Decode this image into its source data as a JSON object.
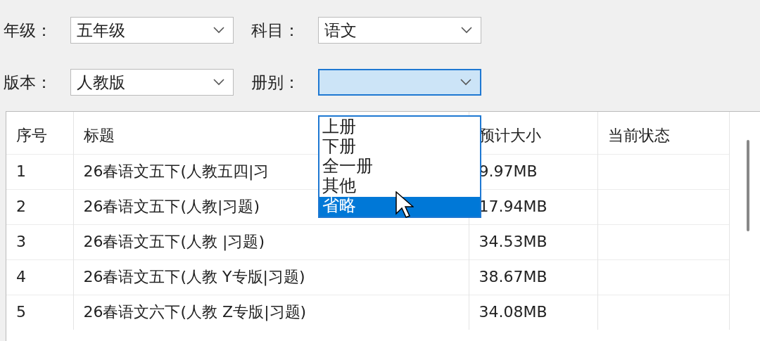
{
  "filters": [
    {
      "label": "年级：",
      "value": "五年级",
      "focused": false
    },
    {
      "label": "科目：",
      "value": "语文",
      "focused": false
    },
    {
      "label": "版本：",
      "value": "人教版",
      "focused": false
    },
    {
      "label": "册别：",
      "focused": true
    }
  ],
  "dropdown": {
    "options": [
      {
        "label": "上册",
        "selected": false
      },
      {
        "label": "下册",
        "selected": false
      },
      {
        "label": "全一册",
        "selected": false
      },
      {
        "label": "其他",
        "selected": false
      },
      {
        "label": "省略",
        "selected": true
      }
    ]
  },
  "table": {
    "columns": [
      "序号",
      "标题",
      "预计大小",
      "当前状态"
    ],
    "rows": [
      [
        "1",
        "26春语文五下(人教五四|习",
        "9.97MB",
        ""
      ],
      [
        "2",
        "26春语文五下(人教|习题)",
        "17.94MB",
        ""
      ],
      [
        "3",
        "26春语文五下(人教 |习题)",
        "34.53MB",
        ""
      ],
      [
        "4",
        "26春语文五下(人教 Y专版|习题)",
        "38.67MB",
        ""
      ],
      [
        "5",
        "26春语文六下(人教 Z专版|习题)",
        "34.08MB",
        ""
      ]
    ]
  }
}
